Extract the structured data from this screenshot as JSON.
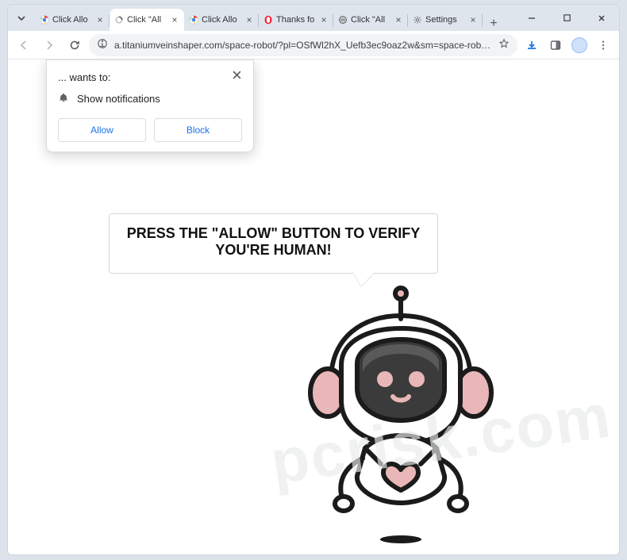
{
  "window": {
    "controls": {
      "minimize": "—",
      "maximize": "□",
      "close": "✕"
    }
  },
  "tabs": {
    "items": [
      {
        "label": "Click Allo",
        "favicon": "chrome"
      },
      {
        "label": "Click \"All",
        "favicon": "loading",
        "active": true
      },
      {
        "label": "Click Allo",
        "favicon": "chrome"
      },
      {
        "label": "Thanks fo",
        "favicon": "opera"
      },
      {
        "label": "Click \"All",
        "favicon": "globe"
      },
      {
        "label": "Settings",
        "favicon": "gear"
      }
    ],
    "newtab": "+"
  },
  "toolbar": {
    "url": "a.titaniumveinshaper.com/space-robot/?pl=OSfWl2hX_Uefb3ec9oaz2w&sm=space-robot&click_i..."
  },
  "permission": {
    "title": "... wants to:",
    "item": "Show notifications",
    "allow": "Allow",
    "block": "Block"
  },
  "page": {
    "speech_line1": "PRESS THE \"ALLOW\" BUTTON TO VERIFY",
    "speech_line2": "YOU'RE HUMAN!"
  },
  "watermark": "pcrisk.com"
}
